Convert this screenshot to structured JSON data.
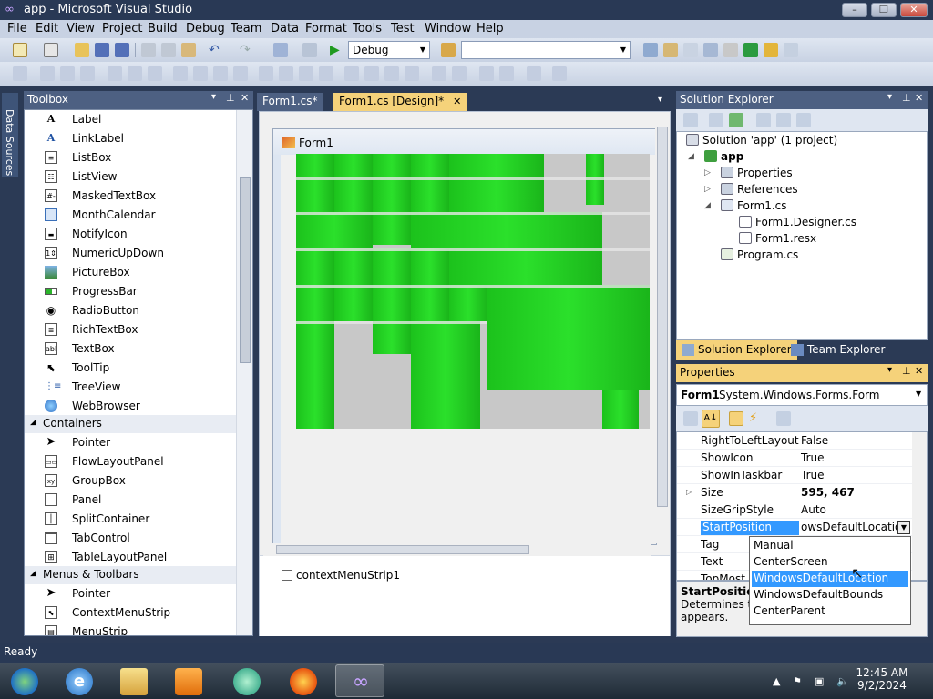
{
  "window": {
    "title": "app - Microsoft Visual Studio"
  },
  "menu": [
    "File",
    "Edit",
    "View",
    "Project",
    "Build",
    "Debug",
    "Team",
    "Data",
    "Format",
    "Tools",
    "Test",
    "Window",
    "Help"
  ],
  "toolbar": {
    "config": "Debug",
    "platform": ""
  },
  "left_strip": {
    "tab": "Data Sources"
  },
  "toolbox": {
    "title": "Toolbox",
    "items_a": [
      "Label",
      "LinkLabel",
      "ListBox",
      "ListView",
      "MaskedTextBox",
      "MonthCalendar",
      "NotifyIcon",
      "NumericUpDown",
      "PictureBox",
      "ProgressBar",
      "RadioButton",
      "RichTextBox",
      "TextBox",
      "ToolTip",
      "TreeView",
      "WebBrowser"
    ],
    "cat_containers": "Containers",
    "items_b": [
      "Pointer",
      "FlowLayoutPanel",
      "GroupBox",
      "Panel",
      "SplitContainer",
      "TabControl",
      "TableLayoutPanel"
    ],
    "cat_menus": "Menus & Toolbars",
    "items_c": [
      "Pointer",
      "ContextMenuStrip",
      "MenuStrip"
    ]
  },
  "tabs": {
    "form1_cs": "Form1.cs*",
    "form1_design": "Form1.cs [Design]*"
  },
  "designer": {
    "form_title": "Form1",
    "tray_component": "contextMenuStrip1"
  },
  "solution_explorer": {
    "title": "Solution Explorer",
    "solution": "Solution 'app' (1 project)",
    "project": "app",
    "properties": "Properties",
    "references": "References",
    "form1_cs": "Form1.cs",
    "form1_designer": "Form1.Designer.cs",
    "form1_resx": "Form1.resx",
    "program_cs": "Program.cs",
    "tab_se": "Solution Explorer",
    "tab_te": "Team Explorer"
  },
  "properties": {
    "title": "Properties",
    "object_name": "Form1",
    "object_type": "System.Windows.Forms.Form",
    "rows": [
      {
        "name": "RightToLeftLayout",
        "value": "False"
      },
      {
        "name": "ShowIcon",
        "value": "True"
      },
      {
        "name": "ShowInTaskbar",
        "value": "True"
      },
      {
        "name": "Size",
        "value": "595, 467"
      },
      {
        "name": "SizeGripStyle",
        "value": "Auto"
      },
      {
        "name": "StartPosition",
        "value": "owsDefaultLocation"
      },
      {
        "name": "Tag",
        "value": ""
      },
      {
        "name": "Text",
        "value": ""
      },
      {
        "name": "TopMost",
        "value": ""
      }
    ],
    "desc_title": "StartPosition",
    "desc_text_1": "Determines th",
    "desc_text_2": "appears."
  },
  "dropdown": [
    "Manual",
    "CenterScreen",
    "WindowsDefaultLocation",
    "WindowsDefaultBounds",
    "CenterParent"
  ],
  "status": "Ready",
  "taskbar": {
    "time": "12:45 AM",
    "date": "9/2/2024"
  }
}
